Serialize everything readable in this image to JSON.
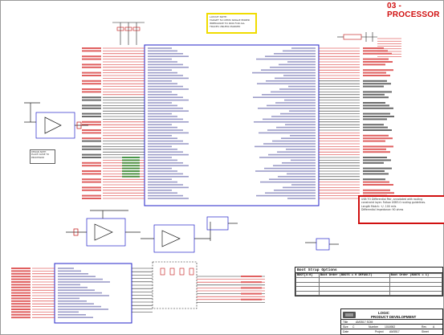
{
  "sheet": {
    "title": "03 - PROCESSOR"
  },
  "notes": {
    "layout_note": [
      "LAYOUT NOTE:",
      "TARGET 50 OHMS SINGLE ENDED",
      "IMPEDANCE TO DDR FOR ALL",
      "TRACES UNLESS MARKED"
    ],
    "routing_note": [
      "USB TO Differential Pair, annotated with routing",
      "constraint layer. Follow USB3.0 routing guidelines.",
      "Length Match: +/- 100 mils",
      "Differential Impedance: 90 ohms"
    ],
    "small_note": [
      "DESIGN NOTE:",
      "PLACE CLOSE TO",
      "PROCESSOR"
    ]
  },
  "boot_table": {
    "title": "Boot Strap Options",
    "headers": [
      "BOOT[4:0]",
      "Boot Order (BOOT5 = 0 DEFAULT)",
      "Boot Order (BOOT5 = 1)"
    ],
    "rows": [
      [
        "",
        "",
        ""
      ],
      [
        "",
        "",
        ""
      ],
      [
        "",
        "",
        ""
      ],
      [
        "",
        "",
        ""
      ]
    ]
  },
  "title_block": {
    "company": "LOGIC",
    "department": "PRODUCT DEVELOPMENT",
    "rows": [
      {
        "label1": "Title",
        "value1": "AM3517 SOM",
        "label2": "",
        "value2": ""
      },
      {
        "label1": "Size",
        "value1": "C",
        "label2": "Number",
        "value2": "1016982",
        "label3": "Rev",
        "value3": "A"
      },
      {
        "label1": "Date",
        "value1": "",
        "label2": "Project",
        "value2": "AM3517",
        "label3": "Sheet",
        "value3": ""
      }
    ]
  },
  "components": {
    "main_ic": "U19",
    "pmic_ic": "U20"
  }
}
